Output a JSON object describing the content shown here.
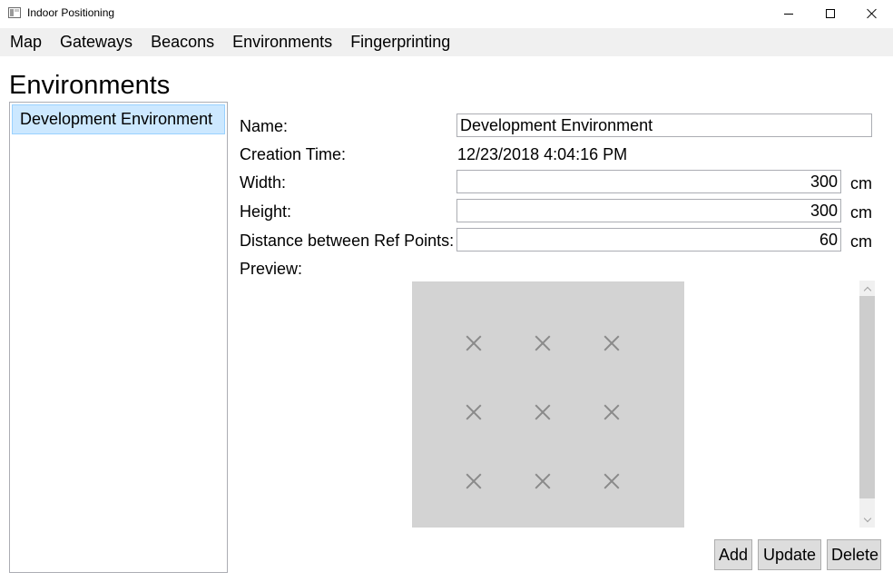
{
  "window": {
    "title": "Indoor Positioning",
    "app_icon": "window-app-icon"
  },
  "menu": [
    {
      "label": "Map"
    },
    {
      "label": "Gateways"
    },
    {
      "label": "Beacons"
    },
    {
      "label": "Environments"
    },
    {
      "label": "Fingerprinting"
    }
  ],
  "page": {
    "title": "Environments"
  },
  "environments": {
    "items": [
      {
        "label": "Development Environment",
        "selected": true
      }
    ]
  },
  "form": {
    "name_label": "Name:",
    "name_value": "Development Environment",
    "creation_label": "Creation Time:",
    "creation_value": "12/23/2018 4:04:16 PM",
    "width_label": "Width:",
    "width_value": "300",
    "width_unit": "cm",
    "height_label": "Height:",
    "height_value": "300",
    "height_unit": "cm",
    "distance_label": "Distance between Ref Points:",
    "distance_value": "60",
    "distance_unit": "cm",
    "preview_label": "Preview:"
  },
  "preview": {
    "background_color": "#d3d3d3",
    "marker_color": "#8a8a8a",
    "marker_icon": "x-mark-icon",
    "grid_rows": 3,
    "grid_cols": 3
  },
  "actions": {
    "add": "Add",
    "update": "Update",
    "delete": "Delete"
  },
  "colors": {
    "selection": "#cce8ff",
    "menubar": "#f0f0f0",
    "button": "#dddddd"
  }
}
